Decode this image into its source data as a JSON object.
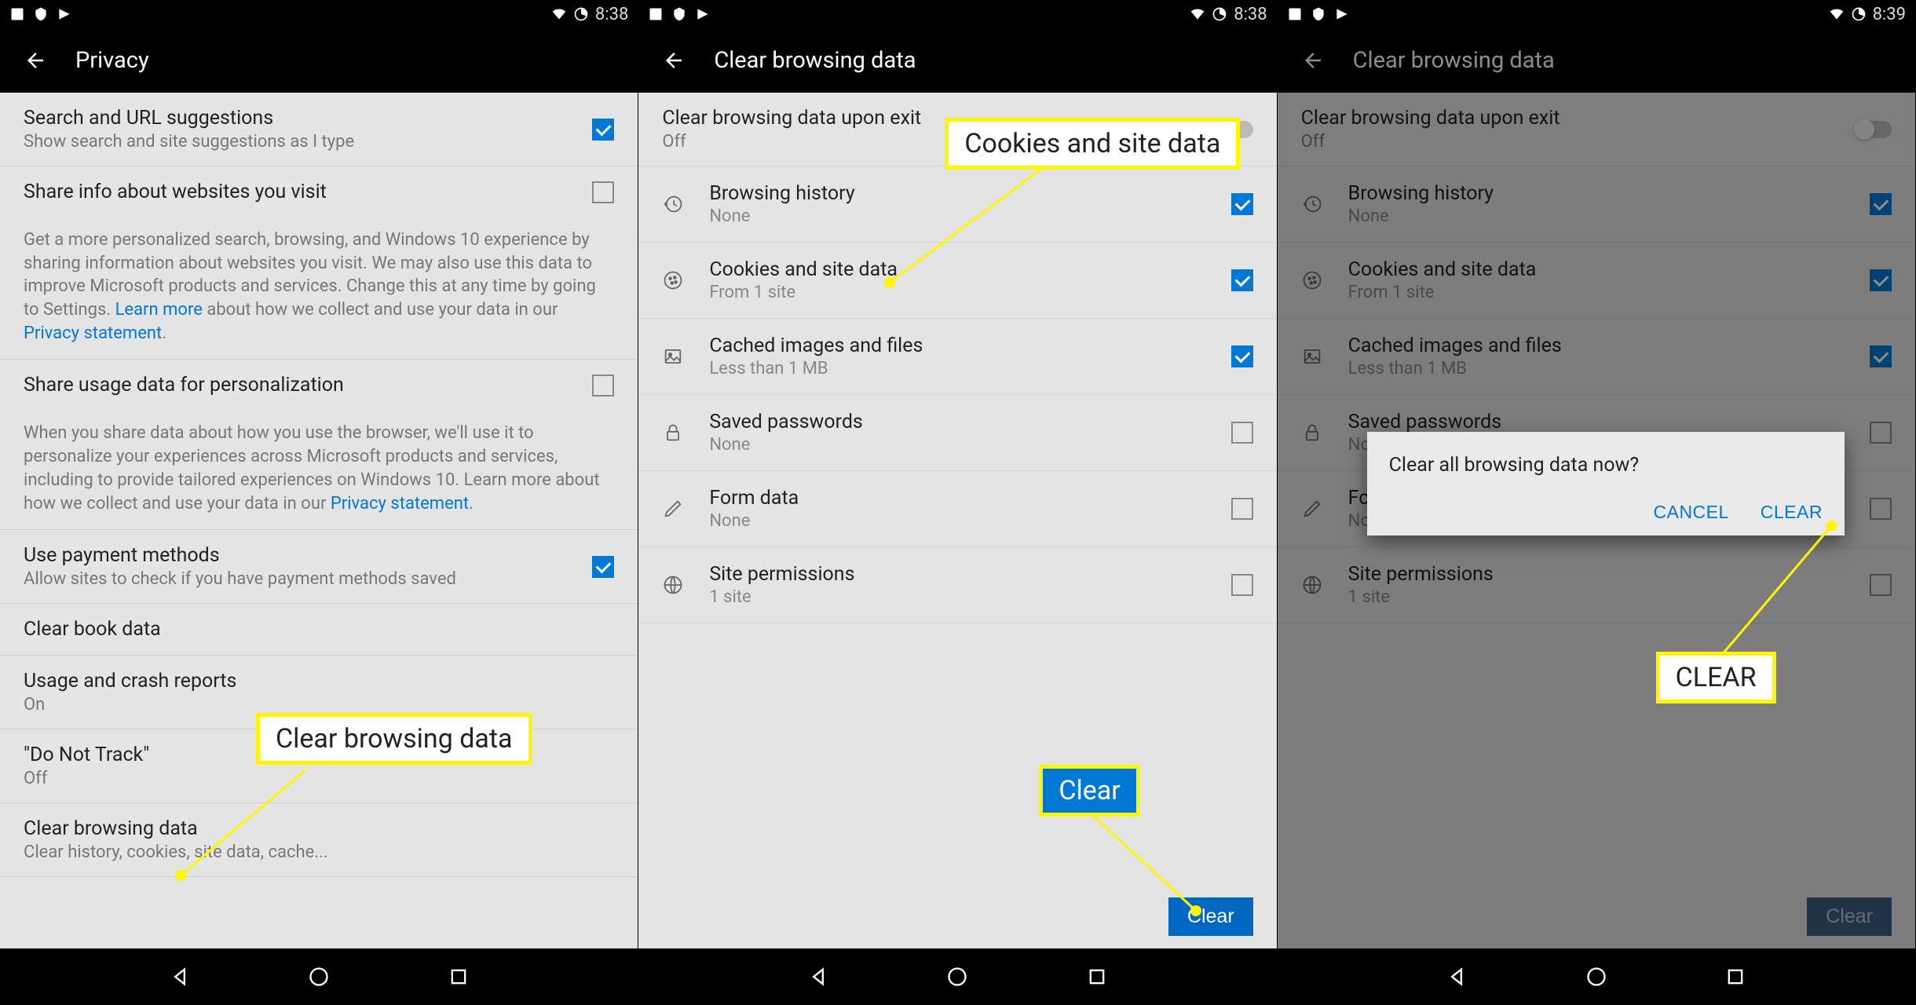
{
  "screen1": {
    "time": "8:38",
    "header": "Privacy",
    "s1_title": "Search and URL suggestions",
    "s1_sub": "Show search and site suggestions as I type",
    "s2_title": "Share info about websites you visit",
    "info1a": "Get a more personalized search, browsing, and Windows 10 experience by sharing information about websites you visit. We may also use this data to improve Microsoft products and services. Change this at any time by going to Settings. ",
    "info1_link1": "Learn more",
    "info1b": " about how we collect and use your data in our ",
    "info1_link2": "Privacy statement",
    "s3_title": "Share usage data for personalization",
    "info2a": "When you share data about how you use the browser, we'll use it to personalize your experiences across Microsoft products and services, including to provide tailored experiences on Windows 10. Learn more about how we collect and use your data in our ",
    "info2_link": "Privacy statement",
    "s4_title": "Use payment methods",
    "s4_sub": "Allow sites to check if you have payment methods saved",
    "s5_title": "Clear book data",
    "s6_title": "Usage and crash reports",
    "s6_sub": "On",
    "s7_title": "\"Do Not Track\"",
    "s7_sub": "Off",
    "s8_title": "Clear browsing data",
    "s8_sub": "Clear history, cookies, site data, cache...",
    "callout": "Clear browsing data"
  },
  "screen2": {
    "time": "8:38",
    "header": "Clear browsing data",
    "exit_title": "Clear browsing data upon exit",
    "exit_sub": "Off",
    "rows": [
      {
        "title": "Browsing history",
        "sub": "None",
        "checked": true
      },
      {
        "title": "Cookies and site data",
        "sub": "From 1 site",
        "checked": true
      },
      {
        "title": "Cached images and files",
        "sub": "Less than 1 MB",
        "checked": true
      },
      {
        "title": "Saved passwords",
        "sub": "None",
        "checked": false
      },
      {
        "title": "Form data",
        "sub": "None",
        "checked": false
      },
      {
        "title": "Site permissions",
        "sub": "1 site",
        "checked": false
      }
    ],
    "clear_btn": "Clear",
    "callout1": "Cookies and site data",
    "callout2": "Clear"
  },
  "screen3": {
    "time": "8:39",
    "header": "Clear browsing data",
    "exit_title": "Clear browsing data upon exit",
    "exit_sub": "Off",
    "rows": [
      {
        "title": "Browsing history",
        "sub": "None",
        "checked": true
      },
      {
        "title": "Cookies and site data",
        "sub": "From 1 site",
        "checked": true
      },
      {
        "title": "Cached images and files",
        "sub": "Less than 1 MB",
        "checked": true
      },
      {
        "title": "Saved passwords",
        "sub": "None",
        "checked": false
      },
      {
        "title": "Form data",
        "sub": "None",
        "checked": false
      },
      {
        "title": "Site permissions",
        "sub": "1 site",
        "checked": false
      }
    ],
    "clear_btn": "Clear",
    "dialog_msg": "Clear all browsing data now?",
    "dialog_cancel": "CANCEL",
    "dialog_clear": "CLEAR",
    "callout": "CLEAR"
  }
}
